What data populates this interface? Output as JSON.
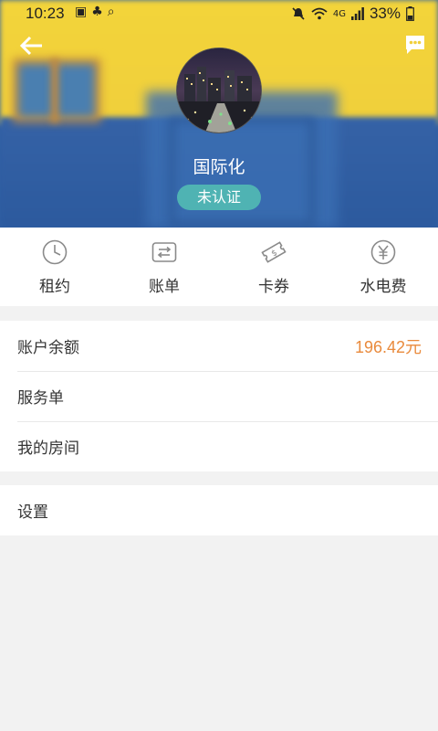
{
  "status_bar": {
    "time": "10:23",
    "left_icons": [
      "image-icon",
      "app-icon",
      "search-icon"
    ],
    "right_icons": [
      "mute-icon",
      "wifi-icon",
      "signal-icon"
    ],
    "network": "4G",
    "battery": "33%"
  },
  "profile": {
    "name": "国际化",
    "verify_status": "未认证"
  },
  "quick_actions": [
    {
      "label": "租约",
      "icon": "clock-icon"
    },
    {
      "label": "账单",
      "icon": "transfer-icon"
    },
    {
      "label": "卡券",
      "icon": "coupon-icon"
    },
    {
      "label": "水电费",
      "icon": "yen-icon"
    }
  ],
  "list": {
    "balance_label": "账户余额",
    "balance_value": "196.42元",
    "service_label": "服务单",
    "room_label": "我的房间",
    "settings_label": "设置"
  },
  "colors": {
    "accent_orange": "#e98a3c",
    "badge_teal": "#4fb3b3",
    "header_yellow": "#f3d43a",
    "header_blue": "#2f5fa3"
  }
}
